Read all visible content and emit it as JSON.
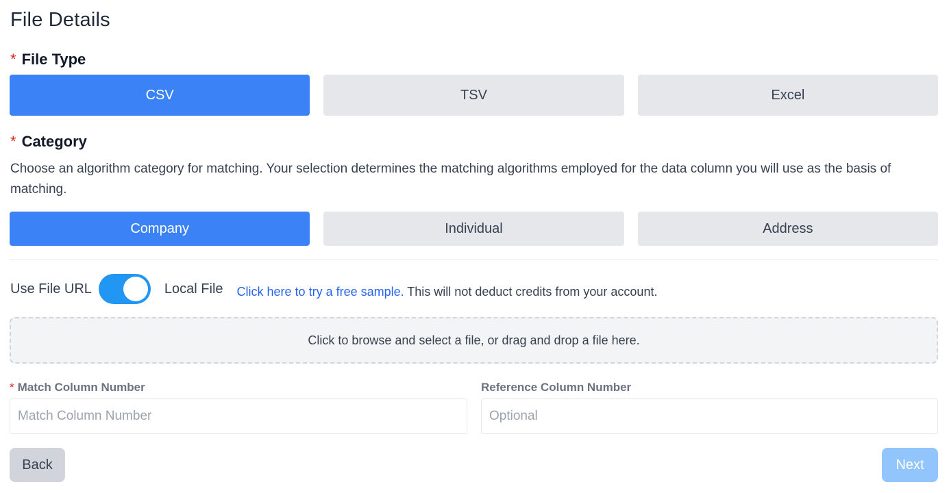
{
  "page": {
    "title": "File Details"
  },
  "file_type": {
    "required_marker": "*",
    "label": "File Type",
    "options": [
      "CSV",
      "TSV",
      "Excel"
    ],
    "selected": "CSV"
  },
  "category": {
    "required_marker": "*",
    "label": "Category",
    "description": "Choose an algorithm category for matching. Your selection determines the matching algorithms employed for the data column you will use as the basis of matching.",
    "options": [
      "Company",
      "Individual",
      "Address"
    ],
    "selected": "Company"
  },
  "source_toggle": {
    "left_label": "Use File URL",
    "right_label": "Local File",
    "state": "on",
    "sample_link": "Click here to try a free sample.",
    "sample_note": " This will not deduct credits from your account."
  },
  "dropzone": {
    "text": "Click to browse and select a file, or drag and drop a file here."
  },
  "fields": {
    "match_column": {
      "required_marker": "*",
      "label": "Match Column Number",
      "placeholder": "Match Column Number",
      "value": ""
    },
    "reference_column": {
      "label": "Reference Column Number",
      "placeholder": "Optional",
      "value": ""
    }
  },
  "actions": {
    "back_label": "Back",
    "next_label": "Next",
    "next_enabled": false
  },
  "colors": {
    "accent": "#3b82f6",
    "toggle": "#2196f3",
    "link": "#2563eb",
    "required": "#dc2626",
    "next_disabled": "#93c5fd"
  }
}
